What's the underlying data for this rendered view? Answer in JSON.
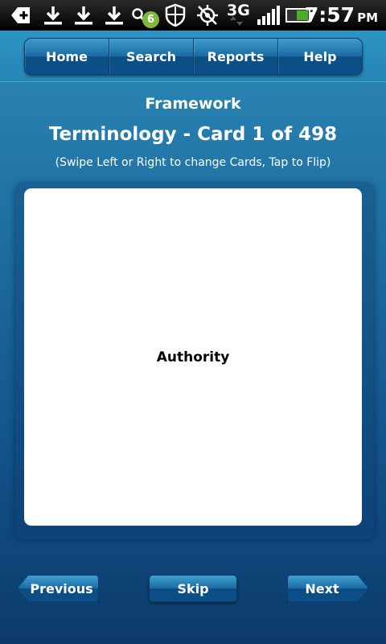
{
  "status_bar": {
    "notification_badge": "6",
    "network": "3G",
    "time": "7:57",
    "ampm": "PM"
  },
  "nav": {
    "items": [
      {
        "label": "Home"
      },
      {
        "label": "Search"
      },
      {
        "label": "Reports"
      },
      {
        "label": "Help"
      }
    ]
  },
  "main": {
    "section_title": "Framework",
    "card_title": "Terminology - Card 1 of 498",
    "hint": "(Swipe Left or Right to change Cards, Tap to Flip)",
    "card_term": "Authority"
  },
  "footer": {
    "previous_label": "Previous",
    "skip_label": "Skip",
    "next_label": "Next"
  },
  "colors": {
    "accent": "#2585b6",
    "badge": "#7fb83a",
    "battery": "#4caf2a"
  }
}
